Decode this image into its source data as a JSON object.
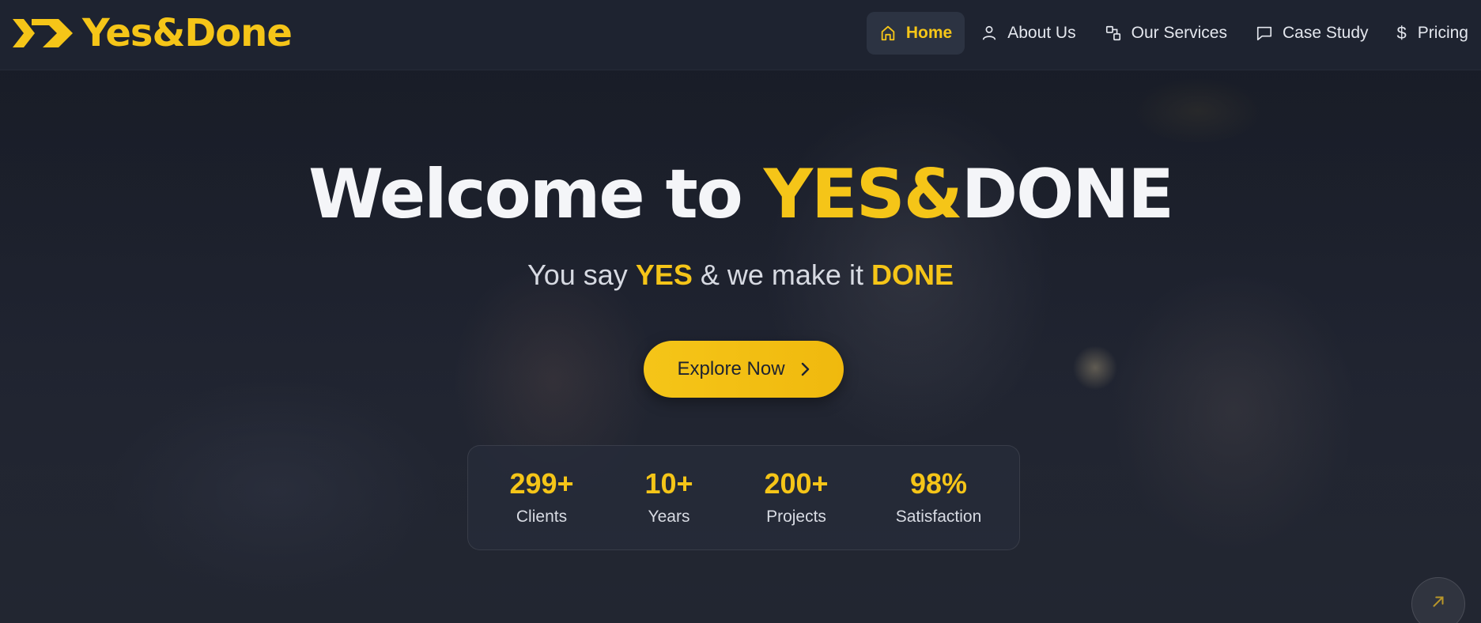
{
  "brand": {
    "name": "Yes&Done",
    "accent": "#f5c518"
  },
  "nav": {
    "items": [
      {
        "label": "Home",
        "icon": "home-icon",
        "active": true
      },
      {
        "label": "About Us",
        "icon": "user-icon",
        "active": false
      },
      {
        "label": "Our Services",
        "icon": "services-icon",
        "active": false
      },
      {
        "label": "Case Study",
        "icon": "message-icon",
        "active": false
      },
      {
        "label": "Pricing",
        "icon": "dollar-icon",
        "active": false
      }
    ]
  },
  "hero": {
    "title_prefix": "Welcome to",
    "title_highlight": "YES&",
    "title_suffix": "DONE",
    "subtitle_a": "You say",
    "subtitle_yes": "YES",
    "subtitle_b": "& we make it",
    "subtitle_done": "DONE",
    "cta_label": "Explore Now",
    "cta_icon": "chevron-right-icon"
  },
  "stats": [
    {
      "value": "299+",
      "label": "Clients"
    },
    {
      "value": "10+",
      "label": "Years"
    },
    {
      "value": "200+",
      "label": "Projects"
    },
    {
      "value": "98%",
      "label": "Satisfaction"
    }
  ],
  "corner_button": {
    "icon": "arrow-up-right-icon"
  }
}
